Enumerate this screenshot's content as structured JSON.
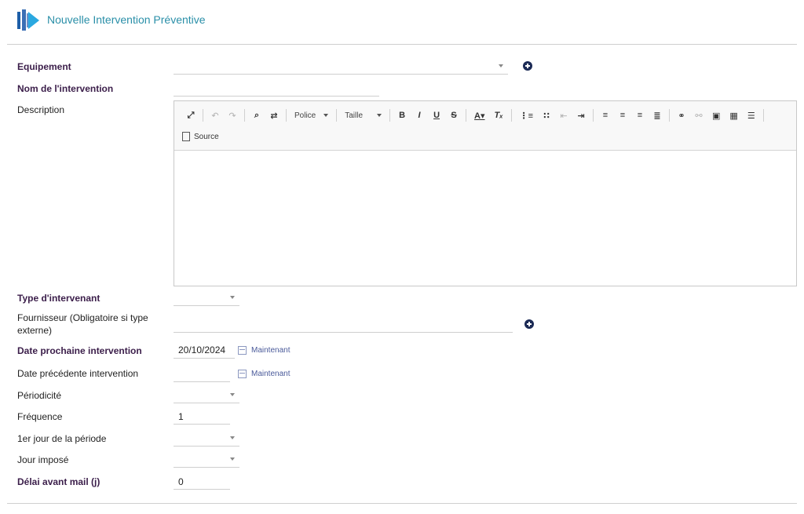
{
  "header": {
    "title": "Nouvelle Intervention Préventive"
  },
  "form": {
    "equipement_label": "Equipement",
    "nom_label": "Nom de l'intervention",
    "description_label": "Description",
    "type_intervenant_label": "Type d'intervenant",
    "fournisseur_label": "Fournisseur (Obligatoire si type externe)",
    "date_prochaine_label": "Date prochaine intervention",
    "date_prochaine_value": "20/10/2024",
    "date_precedente_label": "Date précédente intervention",
    "date_precedente_value": "",
    "periodicite_label": "Périodicité",
    "frequence_label": "Fréquence",
    "frequence_value": "1",
    "premier_jour_label": "1er jour de la période",
    "jour_impose_label": "Jour imposé",
    "delai_label": "Délai avant mail (j)",
    "delai_value": "0",
    "now_link_label": "Maintenant"
  },
  "editor": {
    "toolbar": {
      "police_label": "Police",
      "taille_label": "Taille",
      "source_label": "Source"
    }
  }
}
